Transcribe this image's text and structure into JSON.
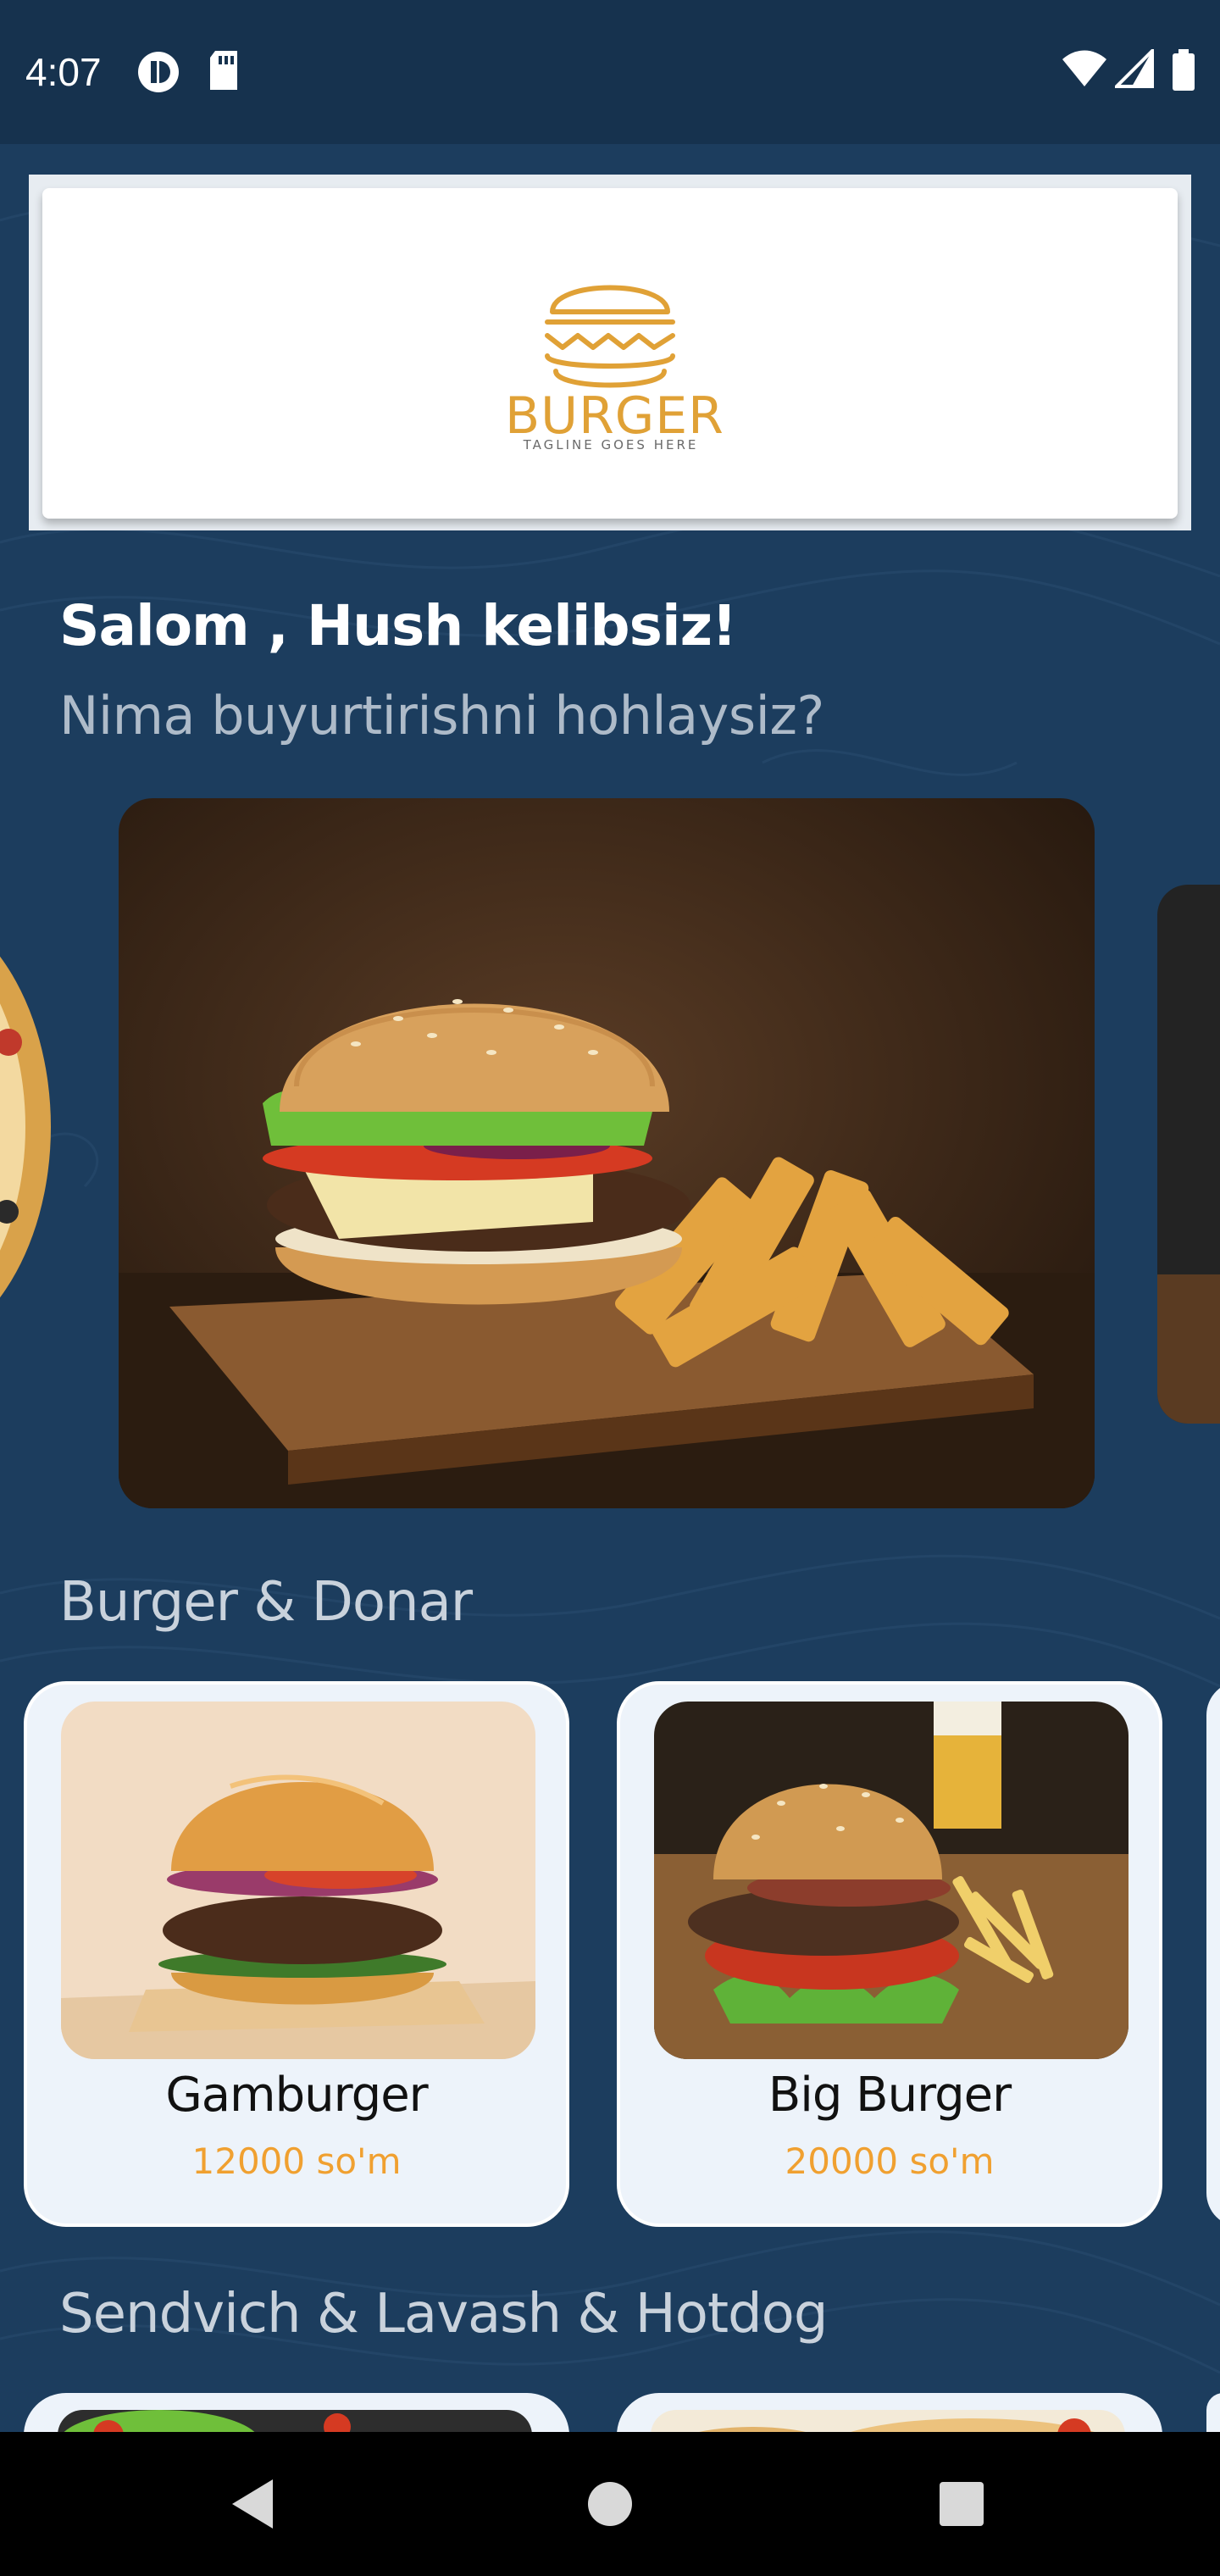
{
  "status_bar": {
    "time": "4:07"
  },
  "banner": {
    "logo_text": "BURGER",
    "logo_tagline": "TAGLINE GOES HERE"
  },
  "greeting": {
    "title": "Salom , Hush kelibsiz!",
    "subtitle": "Nima buyurtirishni hohlaysiz?"
  },
  "sections": [
    {
      "title": "Burger & Donar",
      "items": [
        {
          "name": "Gamburger",
          "price": "12000 so'm"
        },
        {
          "name": "Big Burger",
          "price": "20000 so'm"
        }
      ]
    },
    {
      "title": "Sendvich & Lavash & Hotdog"
    }
  ],
  "colors": {
    "background": "#1c3d5e",
    "accent_price": "#f0a030",
    "logo": "#e0a136",
    "card": "#edf3fa"
  },
  "icons": {
    "nav_back": "back-triangle-icon",
    "nav_home": "home-circle-icon",
    "nav_recents": "recents-square-icon"
  }
}
